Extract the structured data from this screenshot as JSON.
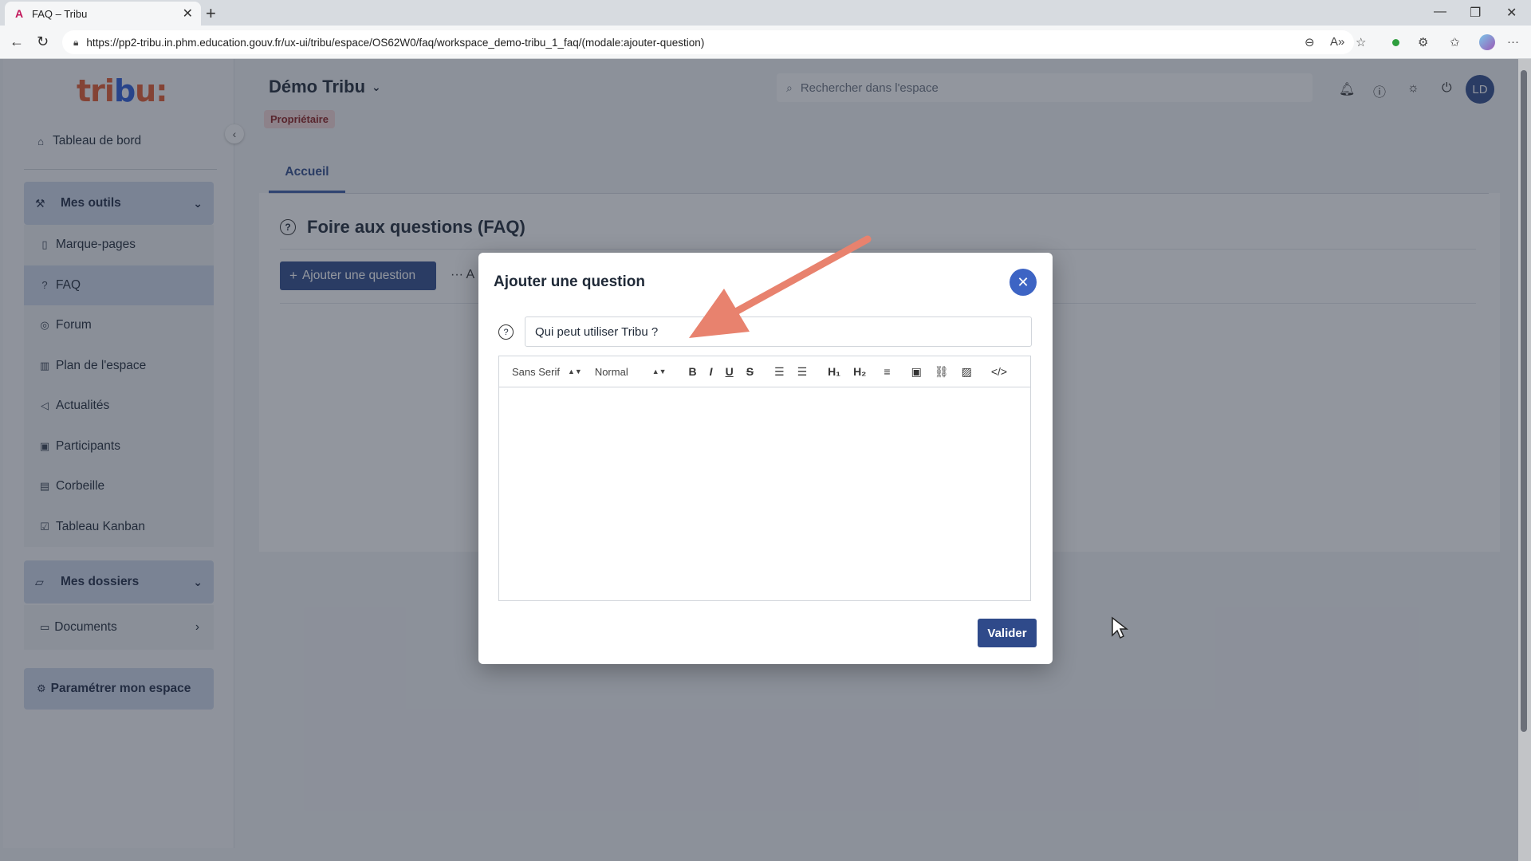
{
  "browser": {
    "tab_title": "FAQ – Tribu",
    "url": "https://pp2-tribu.in.phm.education.gouv.fr/ux-ui/tribu/espace/OS62W0/faq/workspace_demo-tribu_1_faq/(modale:ajouter-question)"
  },
  "sidebar": {
    "logo_prefix": "tri",
    "logo_accent": "b",
    "logo_suffix": "u:",
    "dashboard": "Tableau de bord",
    "tools_group": "Mes outils",
    "tools": [
      "Marque-pages",
      "FAQ",
      "Forum",
      "Plan de l'espace",
      "Actualités",
      "Participants",
      "Corbeille",
      "Tableau Kanban"
    ],
    "active_tool": "FAQ",
    "folders_group": "Mes dossiers",
    "documents": "Documents",
    "settings": "Paramétrer mon espace"
  },
  "header": {
    "space_title": "Démo Tribu",
    "role": "Propriétaire",
    "search_placeholder": "Rechercher dans l'espace",
    "avatar_initials": "LD"
  },
  "main": {
    "tab_home": "Accueil",
    "faq_title": "Foire aux questions (FAQ)",
    "add_question_button": "Ajouter une question",
    "more_label": "A"
  },
  "modal": {
    "title": "Ajouter une question",
    "question_value": "Qui peut utiliser Tribu ?",
    "font_select": "Sans Serif",
    "size_select": "Normal",
    "submit": "Valider"
  },
  "colors": {
    "primary": "#2f4a8a",
    "accent_blue": "#3d64c4",
    "arrow": "#e8826e",
    "badge_bg": "#f4d7d7"
  }
}
